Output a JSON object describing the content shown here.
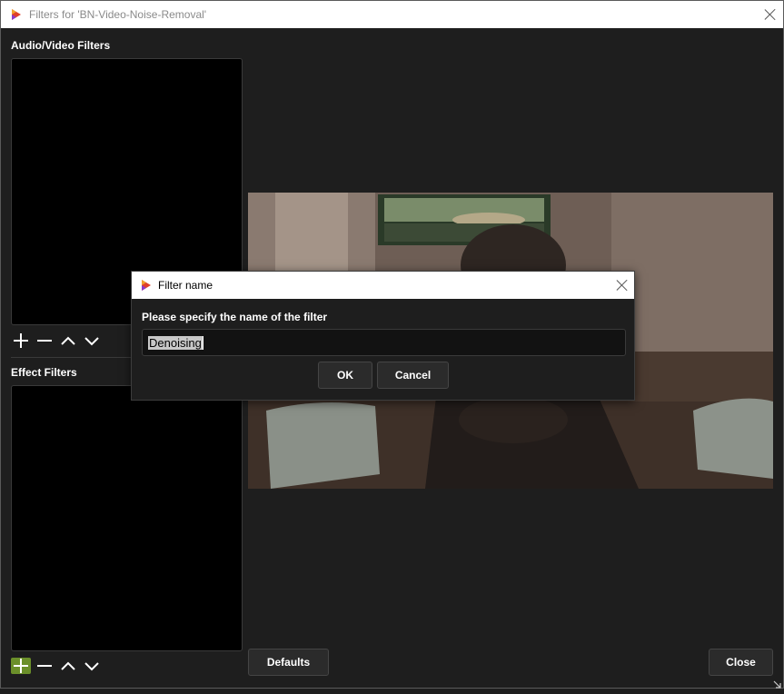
{
  "window": {
    "title": "Filters for 'BN-Video-Noise-Removal'"
  },
  "audio_video_filters": {
    "label": "Audio/Video Filters",
    "items": []
  },
  "effect_filters": {
    "label": "Effect Filters",
    "items": []
  },
  "toolbar_icons": [
    "add-icon",
    "remove-icon",
    "move-up-icon",
    "move-down-icon"
  ],
  "buttons": {
    "defaults": "Defaults",
    "close": "Close"
  },
  "dialog": {
    "title": "Filter name",
    "prompt": "Please specify the name of the filter",
    "input_value": "Denoising",
    "ok": "OK",
    "cancel": "Cancel"
  },
  "colors": {
    "accent_add_button": "#6b8f2a",
    "background": "#1e1e1e",
    "list_bg": "#000000"
  }
}
